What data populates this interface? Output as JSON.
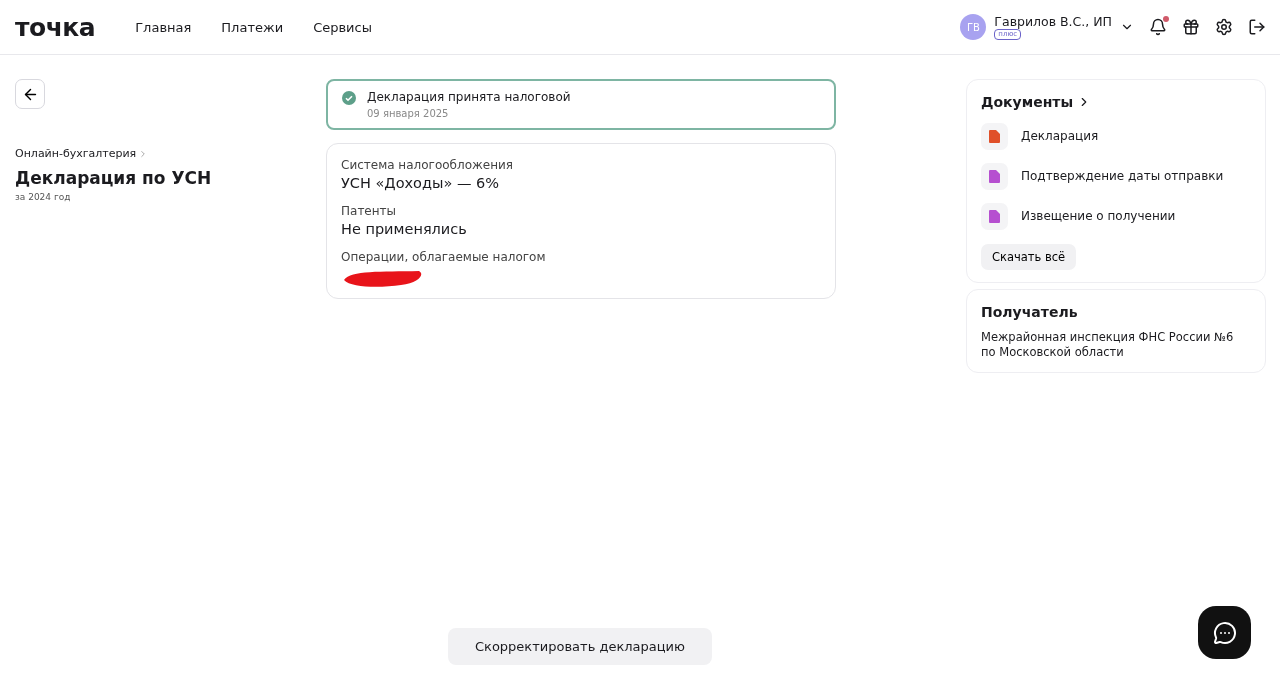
{
  "header": {
    "logo": "точка",
    "nav": [
      {
        "label": "Главная"
      },
      {
        "label": "Платежи"
      },
      {
        "label": "Сервисы"
      }
    ],
    "user": {
      "initials": "ГВ",
      "name": "Гаврилов В.С., ИП",
      "plan": "плюс"
    },
    "notifications_unread": true
  },
  "page": {
    "breadcrumb": "Онлайн-бухгалтерия",
    "title": "Декларация по УСН",
    "subtitle": "за 2024 год"
  },
  "status": {
    "title": "Декларация принята налоговой",
    "date": "09 января 2025"
  },
  "details": [
    {
      "kind": "value",
      "label": "Система налогообложения",
      "value": "УСН «Доходы» — 6%"
    },
    {
      "kind": "value",
      "label": "Патенты",
      "value": "Не применялись"
    },
    {
      "kind": "redacted",
      "label": "Операции, облагаемые налогом"
    }
  ],
  "documents": {
    "title": "Документы",
    "items": [
      {
        "name": "Декларация",
        "color": "#e0502a"
      },
      {
        "name": "Подтверждение даты отправки",
        "color": "#b64fd0"
      },
      {
        "name": "Извещение о получении",
        "color": "#b64fd0"
      }
    ],
    "download": "Скачать всё"
  },
  "recipient": {
    "title": "Получатель",
    "text": "Межрайонная инспекция ФНС России №6 по Московской области"
  },
  "correct_button": "Скорректировать декларацию"
}
